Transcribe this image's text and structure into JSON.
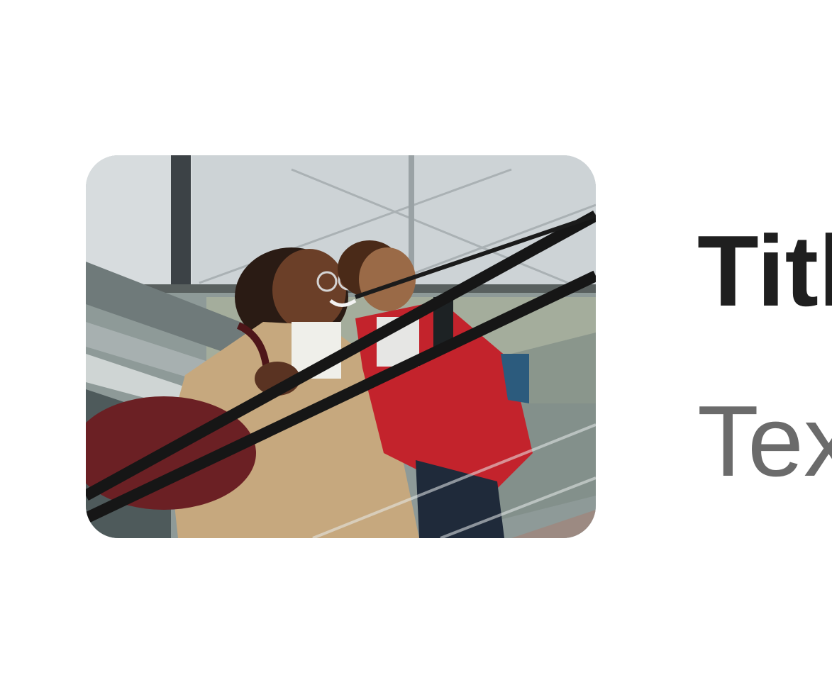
{
  "card": {
    "image": {
      "subject": "photo-escalator-mother-child"
    },
    "title": "Title",
    "text": "Text"
  }
}
